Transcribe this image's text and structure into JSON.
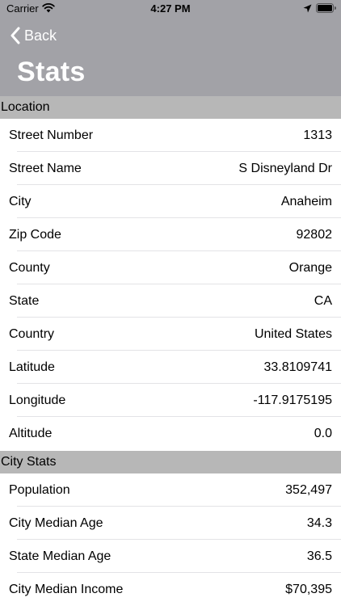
{
  "status_bar": {
    "carrier": "Carrier",
    "time": "4:27 PM"
  },
  "nav": {
    "back_label": "Back",
    "title": "Stats"
  },
  "sections": [
    {
      "title": "Location",
      "rows": [
        {
          "label": "Street Number",
          "value": "1313"
        },
        {
          "label": "Street Name",
          "value": "S Disneyland Dr"
        },
        {
          "label": "City",
          "value": "Anaheim"
        },
        {
          "label": "Zip Code",
          "value": "92802"
        },
        {
          "label": "County",
          "value": "Orange"
        },
        {
          "label": "State",
          "value": "CA"
        },
        {
          "label": "Country",
          "value": "United States"
        },
        {
          "label": "Latitude",
          "value": "33.8109741"
        },
        {
          "label": "Longitude",
          "value": "-117.9175195"
        },
        {
          "label": "Altitude",
          "value": "0.0"
        }
      ]
    },
    {
      "title": "City Stats",
      "rows": [
        {
          "label": "Population",
          "value": "352,497"
        },
        {
          "label": "City Median Age",
          "value": "34.3"
        },
        {
          "label": "State Median Age",
          "value": "36.5"
        },
        {
          "label": "City Median Income",
          "value": "$70,395"
        }
      ]
    }
  ],
  "colors": {
    "header_bg": "#a2a2a7",
    "section_bg": "#b7b7b7",
    "separator": "#e3e3e6"
  },
  "icons": [
    "wifi-icon",
    "location-arrow-icon",
    "battery-icon",
    "chevron-left-icon"
  ]
}
